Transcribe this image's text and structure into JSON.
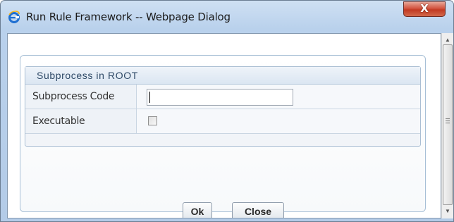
{
  "window": {
    "title": "Run Rule Framework -- Webpage Dialog",
    "close_glyph": "X",
    "app_icon": "ie-icon"
  },
  "form": {
    "header": "Subprocess in ROOT",
    "fields": [
      {
        "label": "Subprocess Code",
        "type": "text",
        "value": ""
      },
      {
        "label": "Executable",
        "type": "checkbox",
        "checked": false
      }
    ]
  },
  "buttons": {
    "ok_label": "Ok",
    "close_label": "Close"
  },
  "scrollbar": {
    "up_glyph": "▲",
    "down_glyph": "▼"
  },
  "colors": {
    "title_bar": "#c4d8ef",
    "close_button": "#c8432b",
    "form_header_text": "#2f4a67"
  }
}
